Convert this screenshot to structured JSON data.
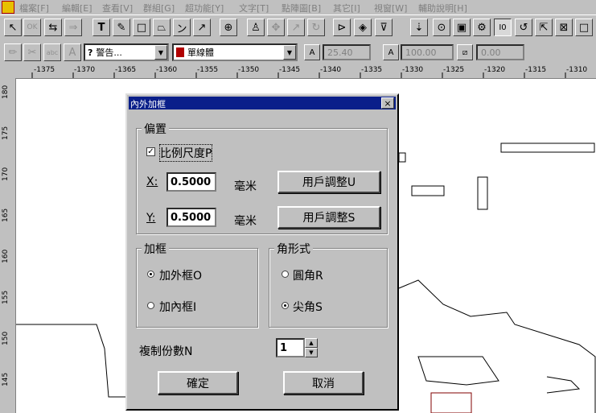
{
  "menu": [
    "檔案[F]",
    "編輯[E]",
    "查看[V]",
    "群組[G]",
    "超功能[Y]",
    "文字[T]",
    "點陣圖[B]",
    "其它[I]",
    "視窗[W]",
    "輔助說明[H]"
  ],
  "toolbar2": {
    "preset_value": "警告...",
    "preset_prefix": "?",
    "font_value": "單線體",
    "field1": "25.40",
    "field2": "100.00",
    "field3": "0.00"
  },
  "ruler": {
    "h_labels": [
      "-1375",
      "-1370",
      "-1365",
      "-1360",
      "-1355",
      "-1350",
      "-1345",
      "-1340",
      "-1335",
      "-1330",
      "-1325",
      "-1320",
      "-1315",
      "-1310"
    ],
    "v_labels": [
      "180",
      "175",
      "170",
      "165",
      "160",
      "155",
      "150",
      "145"
    ]
  },
  "dialog": {
    "title": "內外加框",
    "close": "×",
    "offset_group": "偏置",
    "scale_checkbox": "比例尺度P",
    "scale_checked": true,
    "x_label": "X:",
    "x_value": "0.5000",
    "y_label": "Y:",
    "y_value": "0.5000",
    "unit": "毫米",
    "user_adjust_u": "用戶調整U",
    "user_adjust_s": "用戶調整S",
    "frame_group": "加框",
    "outer_frame": "加外框O",
    "inner_frame": "加內框I",
    "corner_group": "角形式",
    "round_corner": "圓角R",
    "sharp_corner": "尖角S",
    "copies_label": "複制份數N",
    "copies_value": "1",
    "ok": "確定",
    "cancel": "取消"
  }
}
